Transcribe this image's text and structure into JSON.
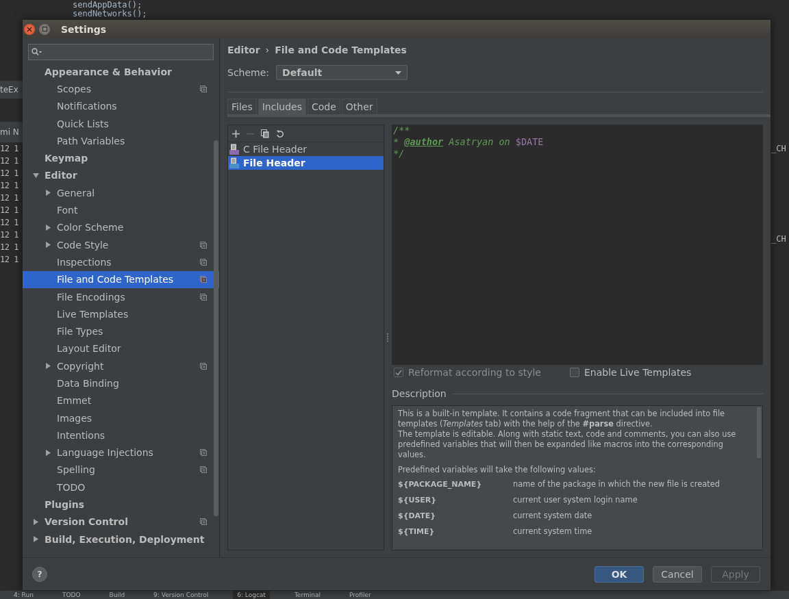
{
  "background": {
    "code_lines": [
      "sendAppData();",
      "sendNetworks();"
    ],
    "left_fragments": [
      {
        "kind": "tab",
        "text": "teEx"
      },
      {
        "kind": "header",
        "text": "mi N"
      }
    ],
    "left_rows": [
      "12 1",
      "12 1",
      "12 1",
      "12 1",
      "12 1",
      "12 1",
      "12 1",
      "12 1",
      "12 1",
      "12 1"
    ],
    "right_fragments": [
      "_CH",
      "_CH"
    ],
    "bottom_tabs": [
      {
        "label": "4: Run",
        "selected": false
      },
      {
        "label": "TODO",
        "selected": false
      },
      {
        "label": "Build",
        "selected": false
      },
      {
        "label": "9: Version Control",
        "selected": false
      },
      {
        "label": "6: Logcat",
        "selected": true
      },
      {
        "label": "Terminal",
        "selected": false
      },
      {
        "label": "Profiler",
        "selected": false
      }
    ]
  },
  "window": {
    "title": "Settings"
  },
  "sidebar": {
    "items": [
      {
        "label": "Appearance & Behavior",
        "selected": false,
        "project": false,
        "children": [
          {
            "label": "Scopes",
            "selected": false,
            "project": true
          },
          {
            "label": "Notifications",
            "selected": false,
            "project": false
          },
          {
            "label": "Quick Lists",
            "selected": false,
            "project": false
          },
          {
            "label": "Path Variables",
            "selected": false,
            "project": false
          }
        ]
      },
      {
        "label": "Keymap",
        "selected": false,
        "project": false
      },
      {
        "label": "Editor",
        "selected": false,
        "project": false,
        "expanded": true,
        "children": [
          {
            "label": "General",
            "selected": false,
            "project": false,
            "expanded": false
          },
          {
            "label": "Font",
            "selected": false,
            "project": false
          },
          {
            "label": "Color Scheme",
            "selected": false,
            "project": false,
            "expanded": false
          },
          {
            "label": "Code Style",
            "selected": false,
            "project": true,
            "expanded": false
          },
          {
            "label": "Inspections",
            "selected": false,
            "project": true
          },
          {
            "label": "File and Code Templates",
            "selected": true,
            "project": true
          },
          {
            "label": "File Encodings",
            "selected": false,
            "project": true
          },
          {
            "label": "Live Templates",
            "selected": false,
            "project": false
          },
          {
            "label": "File Types",
            "selected": false,
            "project": false
          },
          {
            "label": "Layout Editor",
            "selected": false,
            "project": false
          },
          {
            "label": "Copyright",
            "selected": false,
            "project": true,
            "expanded": false
          },
          {
            "label": "Data Binding",
            "selected": false,
            "project": false
          },
          {
            "label": "Emmet",
            "selected": false,
            "project": false
          },
          {
            "label": "Images",
            "selected": false,
            "project": false
          },
          {
            "label": "Intentions",
            "selected": false,
            "project": false
          },
          {
            "label": "Language Injections",
            "selected": false,
            "project": true,
            "expanded": false
          },
          {
            "label": "Spelling",
            "selected": false,
            "project": true
          },
          {
            "label": "TODO",
            "selected": false,
            "project": false
          }
        ]
      },
      {
        "label": "Plugins",
        "selected": false,
        "project": false
      },
      {
        "label": "Version Control",
        "selected": false,
        "project": true,
        "expanded": false
      },
      {
        "label": "Build, Execution, Deployment",
        "selected": false,
        "project": false,
        "expanded": false
      }
    ]
  },
  "breadcrumb": {
    "items": [
      "Editor",
      "File and Code Templates"
    ],
    "separator": "›"
  },
  "scheme": {
    "label": "Scheme:",
    "value": "Default"
  },
  "tabs": [
    {
      "label": "Files",
      "selected": false
    },
    {
      "label": "Includes",
      "selected": true
    },
    {
      "label": "Code",
      "selected": false
    },
    {
      "label": "Other",
      "selected": false
    }
  ],
  "templates": {
    "toolbar": [
      {
        "kind": "add",
        "disabled": false
      },
      {
        "kind": "remove",
        "disabled": true
      },
      {
        "kind": "copy",
        "disabled": false
      },
      {
        "kind": "reset",
        "disabled": false
      }
    ],
    "items": [
      {
        "label": "C File Header",
        "kind": "cpp",
        "selected": false
      },
      {
        "label": "File Header",
        "kind": "java",
        "selected": true
      }
    ]
  },
  "editor": {
    "lines": [
      [
        {
          "kind": "comment",
          "text": "/**"
        }
      ],
      [
        {
          "kind": "comment",
          "text": "* "
        },
        {
          "kind": "tag",
          "text": "@author"
        },
        {
          "kind": "comment",
          "text": " Asatryan on "
        },
        {
          "kind": "variable",
          "text": "$DATE"
        }
      ],
      [
        {
          "kind": "comment",
          "text": "*/"
        }
      ]
    ]
  },
  "options": [
    {
      "label": "Reformat according to style",
      "checked": true,
      "disabled": true
    },
    {
      "label": "Enable Live Templates",
      "checked": false,
      "disabled": false
    }
  ],
  "description": {
    "title": "Description",
    "paragraphs": [
      "This is a built-in template. It contains a code fragment that can be included into file templates (*Templates* tab) with the help of the **#parse** directive.",
      "The template is editable. Along with static text, code and comments, you can also use predefined variables that will then be expanded like macros into the corresponding values."
    ],
    "intro": "Predefined variables will take the following values:",
    "variables": [
      {
        "name": "${PACKAGE_NAME}",
        "meaning": "name of the package in which the new file is created"
      },
      {
        "name": "${USER}",
        "meaning": "current user system login name"
      },
      {
        "name": "${DATE}",
        "meaning": "current system date"
      },
      {
        "name": "${TIME}",
        "meaning": "current system time"
      }
    ]
  },
  "help": "?",
  "buttons": [
    {
      "label": "OK",
      "kind": "default",
      "disabled": false
    },
    {
      "label": "Cancel",
      "kind": "normal",
      "disabled": false
    },
    {
      "label": "Apply",
      "kind": "normal",
      "disabled": true
    }
  ]
}
